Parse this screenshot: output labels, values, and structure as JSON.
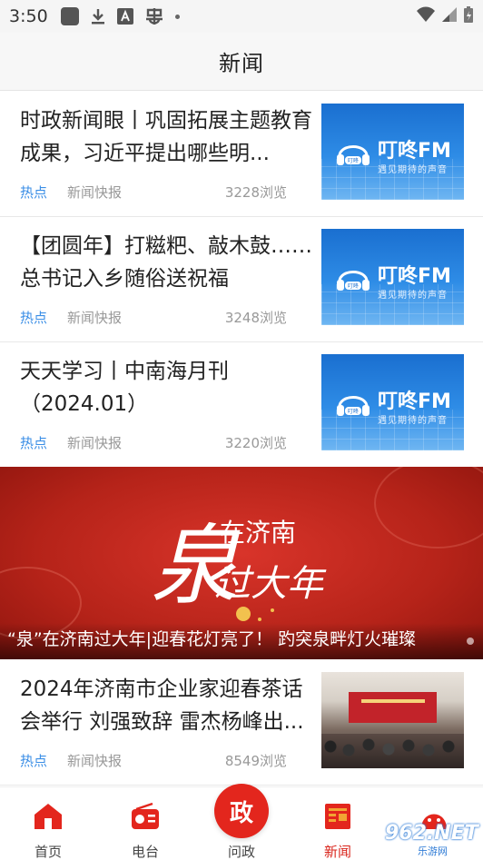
{
  "status_bar": {
    "time": "3:50",
    "icons": [
      "square-icon",
      "download-icon",
      "a-icon",
      "bug-icon",
      "dot-icon"
    ],
    "right_icons": [
      "wifi-icon",
      "signal-icon",
      "battery-icon"
    ]
  },
  "header": {
    "title": "新闻"
  },
  "articles": [
    {
      "title": "时政新闻眼丨巩固拓展主题教育成果，习近平提出哪些明...",
      "tag": "热点",
      "source": "新闻快报",
      "views": "3228浏览",
      "thumb_type": "fm",
      "fm_text": "叮咚FM",
      "fm_sub": "遇见期待的声音",
      "fm_badge": "叮咚"
    },
    {
      "title": "【团圆年】打糍粑、敲木鼓……总书记入乡随俗送祝福",
      "tag": "热点",
      "source": "新闻快报",
      "views": "3248浏览",
      "thumb_type": "fm",
      "fm_text": "叮咚FM",
      "fm_sub": "遇见期待的声音",
      "fm_badge": "叮咚"
    },
    {
      "title": "天天学习丨中南海月刊（2024.01）",
      "tag": "热点",
      "source": "新闻快报",
      "views": "3220浏览",
      "thumb_type": "fm",
      "fm_text": "叮咚FM",
      "fm_sub": "遇见期待的声音",
      "fm_badge": "叮咚"
    }
  ],
  "banner": {
    "big_char": "泉",
    "line1": "在济南",
    "line2": "过大年",
    "caption": "“泉”在济南过大年|迎春花灯亮了！ 趵突泉畔灯火璀璨"
  },
  "article_after_banner": {
    "title": "2024年济南市企业家迎春茶话会举行 刘强致辞 雷杰杨峰出...",
    "tag": "热点",
    "source": "新闻快报",
    "views": "8549浏览"
  },
  "bottom_nav": {
    "items": [
      {
        "label": "首页",
        "icon": "home-icon"
      },
      {
        "label": "电台",
        "icon": "radio-icon"
      },
      {
        "label": "问政",
        "icon": "politics-icon",
        "glyph": "政"
      },
      {
        "label": "新闻",
        "icon": "news-icon"
      },
      {
        "label": "",
        "icon": "profile-icon"
      }
    ],
    "active": "新闻"
  },
  "watermark": {
    "text": "962.NET",
    "sub": "乐游网"
  },
  "colors": {
    "accent_red": "#e3261d",
    "tag_blue": "#3a8ee6",
    "meta_gray": "#999999"
  }
}
